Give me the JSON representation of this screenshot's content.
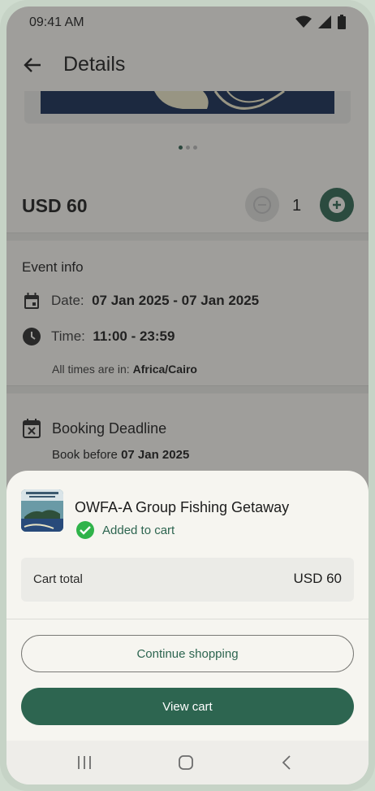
{
  "status": {
    "time": "09:41 AM"
  },
  "app_bar": {
    "title": "Details"
  },
  "carousel": {
    "dots": 3,
    "active_index": 0
  },
  "price": {
    "label": "USD 60"
  },
  "quantity": {
    "value": "1"
  },
  "event_info": {
    "title": "Event info",
    "date_label": "Date:",
    "date_value": "07 Jan 2025 - 07 Jan 2025",
    "time_label": "Time:",
    "time_value": "11:00 - 23:59",
    "tz_prefix": "All times are in:",
    "tz_value": "Africa/Cairo"
  },
  "booking": {
    "title": "Booking Deadline",
    "prefix": "Book before",
    "date": "07 Jan 2025"
  },
  "sheet": {
    "product_title": "OWFA-A Group Fishing Getaway",
    "added_text": "Added to cart",
    "cart_total_label": "Cart total",
    "cart_total_value": "USD 60",
    "continue_label": "Continue shopping",
    "view_cart_label": "View cart"
  },
  "colors": {
    "primary": "#2d6550",
    "success": "#2fb34a"
  }
}
